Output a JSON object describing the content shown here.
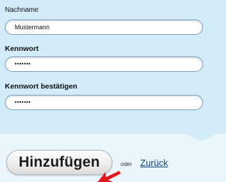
{
  "form": {
    "lastname": {
      "label": "Nachname",
      "value": "Mustermann"
    },
    "password": {
      "label": "Kennwort",
      "value": "•••••••"
    },
    "password_confirm": {
      "label": "Kennwort bestätigen",
      "value": "•••••••"
    }
  },
  "actions": {
    "submit_label": "Hinzufügen",
    "or_text": "oder",
    "back_label": "Zurück"
  },
  "colors": {
    "form_background": "#d3ecf9",
    "footer_background": "#eaf5fc",
    "input_border": "#7c99b8",
    "link": "#0e3f84",
    "pointer_arrow": "#e3171b"
  },
  "icons": {
    "pointer": "red-pointer-arrow-icon"
  }
}
